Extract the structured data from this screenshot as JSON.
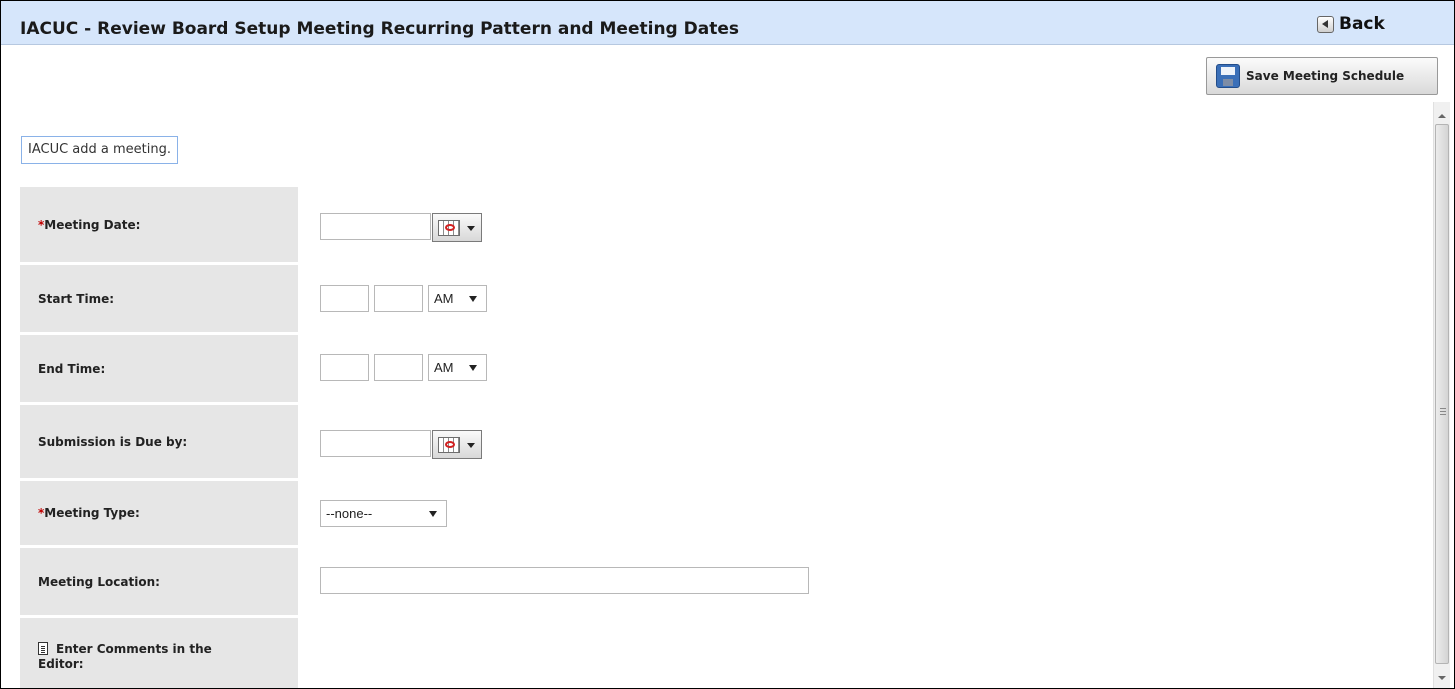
{
  "header": {
    "title": "IACUC - Review Board Setup Meeting Recurring Pattern and Meeting Dates",
    "back_label": "Back"
  },
  "toolbar": {
    "save_label": "Save Meeting Schedule"
  },
  "info": {
    "message": "IACUC add a meeting."
  },
  "form": {
    "required_marker": "*",
    "meeting_date": {
      "label": "Meeting Date:",
      "value": ""
    },
    "start_time": {
      "label": "Start Time:",
      "hour": "",
      "minute": "",
      "ampm": "AM"
    },
    "end_time": {
      "label": "End Time:",
      "hour": "",
      "minute": "",
      "ampm": "AM"
    },
    "submission_due": {
      "label": "Submission is Due by:",
      "value": ""
    },
    "meeting_type": {
      "label": "Meeting Type:",
      "selected": "--none--"
    },
    "meeting_location": {
      "label": "Meeting Location:",
      "value": ""
    },
    "comments": {
      "label": "Enter Comments in the Editor:"
    }
  },
  "icons": {
    "back": "back-arrow-icon",
    "save": "floppy-disk-icon",
    "calendar": "calendar-icon",
    "comments": "document-icon"
  }
}
